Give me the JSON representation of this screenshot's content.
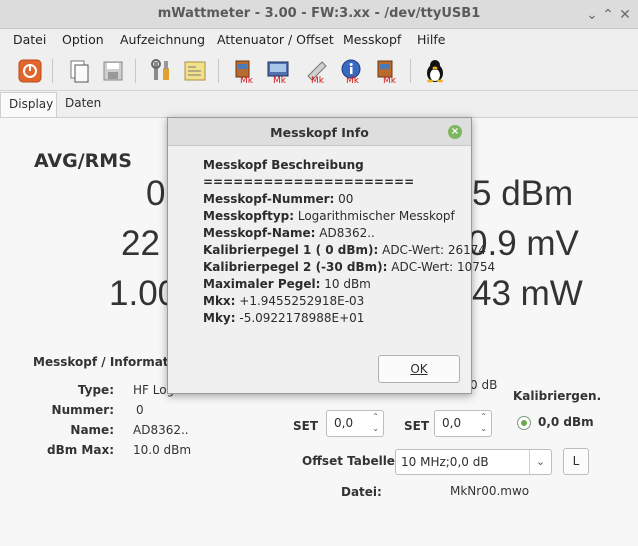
{
  "window": {
    "title": "mWattmeter - 3.00 - FW:3.xx - /dev/ttyUSB1"
  },
  "menu": [
    "Datei",
    "Option",
    "Aufzeichnung",
    "Attenuator / Offset",
    "Messkopf",
    "Hilfe"
  ],
  "toolbar": {
    "icons": [
      "power-icon",
      "copy-icon",
      "save-icon",
      "tools-icon",
      "note-icon",
      "messkopf-a-icon",
      "messkopf-b-icon",
      "messkopf-c-icon",
      "messkopf-info-icon",
      "messkopf-d-icon",
      "linux-icon"
    ],
    "mk_label": "Mk"
  },
  "tabs": [
    "Display",
    "Daten"
  ],
  "display": {
    "title": "AVG/RMS",
    "row1": {
      "left": "0",
      "right": "5 dBm"
    },
    "row2": {
      "left": "22",
      "right": "0.9 mV"
    },
    "row3": {
      "left": "1.00",
      "right": "43 mW"
    }
  },
  "messkopf_info": {
    "title": "Messkopf / Information",
    "type_label": "Type:",
    "type_value": "HF Log",
    "nummer_label": "Nummer:",
    "nummer_value": "0",
    "name_label": "Name:",
    "name_value": "AD8362..",
    "dbmmax_label": "dBm Max:",
    "dbmmax_value": "10.0 dBm"
  },
  "controls": {
    "offset_partial": "0 dB",
    "set1_label": "SET",
    "set1_value": "0,0",
    "set2_label": "SET",
    "set2_value": "0,0",
    "kalibrier_label": "Kalibriergen.",
    "kalibrier_value": "0,0 dBm",
    "offset_tabelle_label": "Offset Tabelle",
    "offset_tabelle_value": "10 MHz;0,0 dB",
    "l_button": "L",
    "datei_label": "Datei:",
    "datei_value": "MkNr00.mwo"
  },
  "dialog": {
    "title": "Messkopf Info",
    "heading": "Messkopf Beschreibung",
    "separator": "=====================",
    "lines": [
      {
        "key": "Messkopf-Nummer:",
        "value": " 00"
      },
      {
        "key": "Messkopftyp:",
        "value": " Logarithmischer Messkopf"
      },
      {
        "key": "Messkopf-Name:",
        "value": " AD8362.."
      },
      {
        "key": "Kalibrierpegel 1 ( 0 dBm):",
        "value": " ADC-Wert: 26174"
      },
      {
        "key": "Kalibrierpegel 2 (-30 dBm):",
        "value": " ADC-Wert: 10754"
      },
      {
        "key": "Maximaler Pegel:",
        "value": " 10 dBm"
      },
      {
        "key": "Mkx:",
        "value": " +1.9455252918E-03"
      },
      {
        "key": "Mky:",
        "value": " -5.0922178988E+01"
      }
    ],
    "ok_label": "OK"
  }
}
